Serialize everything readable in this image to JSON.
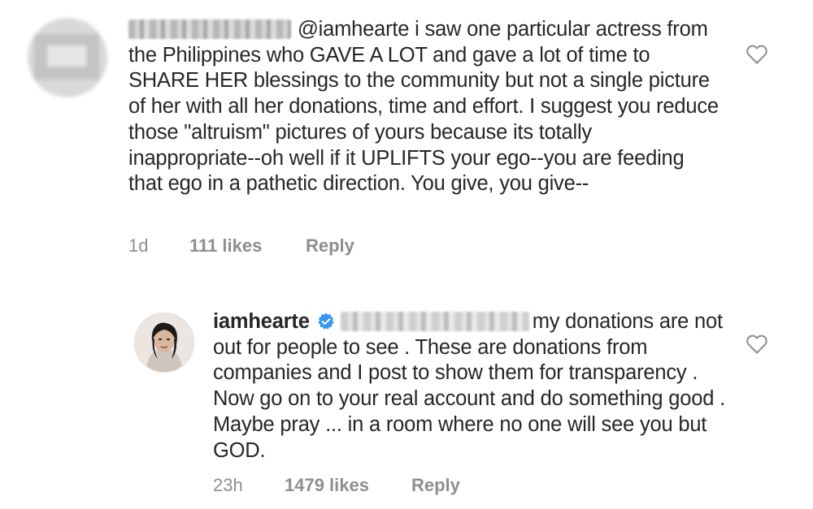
{
  "comments": [
    {
      "mention": "@iamhearte",
      "text": " i saw one particular actress from the Philippines who GAVE A LOT and gave a lot of time to SHARE HER blessings to the community but not a single picture of her with all her donations, time and effort. I suggest you reduce those \"altruism\" pictures of yours because its totally inappropriate--oh well if it UPLIFTS your ego--you are feeding that ego in a pathetic direction. You give, you give--",
      "time": "1d",
      "likes": "111 likes",
      "reply": "Reply",
      "like_icon": "heart-outline-icon"
    },
    {
      "username": "iamhearte",
      "verified_icon": "verified-badge-icon",
      "text": "my donations are not out for people to see . These are donations from companies and I post to show them for transparency . Now go on to your real account and do something good . Maybe pray ... in a room where no one will see you but GOD.",
      "time": "23h",
      "likes": "1479 likes",
      "reply": "Reply",
      "like_icon": "heart-outline-icon"
    }
  ],
  "colors": {
    "text": "#262626",
    "meta": "#8e8e8e",
    "verified": "#3897f0"
  }
}
